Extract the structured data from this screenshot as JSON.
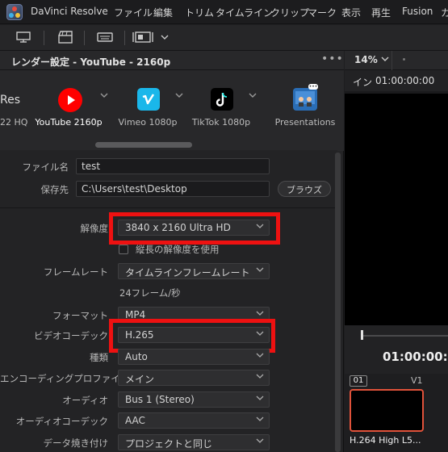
{
  "menubar": {
    "app_title": "DaVinci Resolve",
    "items": [
      "ファイル",
      "編集",
      "トリム",
      "タイムライン",
      "クリップ",
      "マーク",
      "表示",
      "再生",
      "Fusion",
      "カ"
    ]
  },
  "toolbar": {
    "icons": [
      "monitor-icon",
      "clapper-icon",
      "keyboard-icon",
      "viewer-layout-icon",
      "chevron-down-icon"
    ]
  },
  "render_panel": {
    "title": "レンダー設定 - YouTube - 2160p",
    "more": "•••",
    "presets": [
      {
        "label": "Res",
        "sub": "22 HQ"
      },
      {
        "label": "YouTube 2160p",
        "color": "#ff0000"
      },
      {
        "label": "Vimeo 1080p",
        "color": "#1ab7ea"
      },
      {
        "label": "TikTok 1080p",
        "color": "#000000"
      },
      {
        "label": "Presentations",
        "color": "#2a6db5"
      }
    ],
    "file_name_label": "ファイル名",
    "file_name_value": "test",
    "save_to_label": "保存先",
    "save_to_value": "C:\\Users\\test\\Desktop",
    "browse_label": "ブラウズ",
    "resolution_label": "解像度",
    "resolution_value": "3840 x 2160 Ultra HD",
    "vertical_res_label": "縦長の解像度を使用",
    "framerate_label": "フレームレート",
    "framerate_value": "タイムラインフレームレート",
    "framerate_info": "24フレーム/秒",
    "format_label": "フォーマット",
    "format_value": "MP4",
    "video_codec_label": "ビデオコーデック",
    "video_codec_value": "H.265",
    "type_label": "種類",
    "type_value": "Auto",
    "encoding_profile_label": "エンコーディングプロファイル",
    "encoding_profile_value": "メイン",
    "audio_label": "オーディオ",
    "audio_value": "Bus 1 (Stereo)",
    "audio_codec_label": "オーディオコーデック",
    "audio_codec_value": "AAC",
    "data_burn_label": "データ焼き付け",
    "data_burn_value": "プロジェクトと同じ"
  },
  "viewer": {
    "zoom": "14%",
    "in_label": "イン",
    "in_timecode": "01:00:00:00",
    "timecode": "01:00:00:00",
    "track_number": "01",
    "track_name": "V1",
    "clip_name": "H.264 High L5..."
  },
  "colors": {
    "highlight": "#ee1111",
    "clip_border": "#e0523a"
  }
}
